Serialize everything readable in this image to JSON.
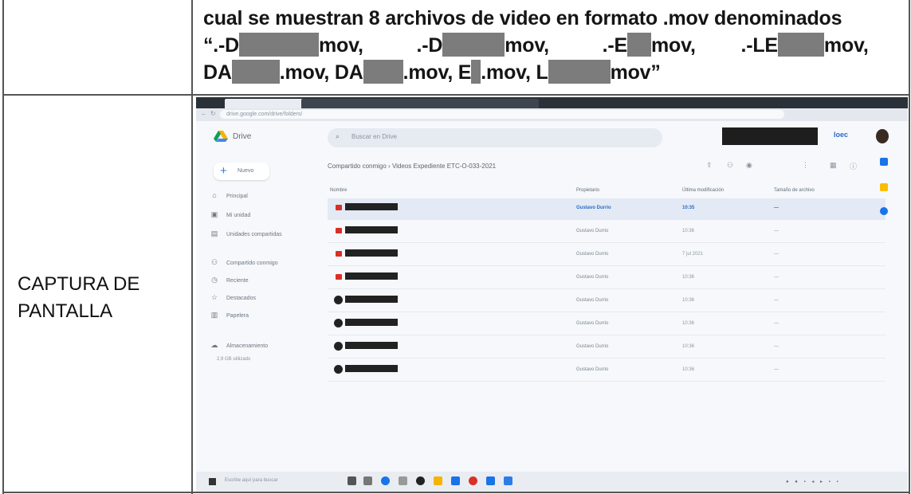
{
  "document": {
    "description_line1": "cual se muestran 8 archivos de video en formato .mov denominados",
    "line2_parts": [
      "“.-D",
      "mov,",
      ".-D",
      "mov,",
      ".-E",
      "mov,",
      ".-LE",
      "mov,"
    ],
    "line3_parts": [
      "DA",
      ".mov, DA",
      ".mov, E",
      ".mov, L",
      "mov”"
    ],
    "side_label_line1": "CAPTURA DE",
    "side_label_line2": "PANTALLA"
  },
  "screenshot": {
    "app_name": "Drive",
    "search_placeholder": "Buscar en Drive",
    "new_button": "Nuevo",
    "top_right_text": "loec",
    "sidebar": [
      {
        "icon": "home-icon",
        "glyph": "⌂",
        "label": "Principal"
      },
      {
        "icon": "my-drive-icon",
        "glyph": "▣",
        "label": "Mi unidad"
      },
      {
        "icon": "computers-icon",
        "glyph": "▤",
        "label": "Unidades compartidas"
      },
      {
        "icon": "shared-icon",
        "glyph": "👥",
        "label": "Compartido conmigo"
      },
      {
        "icon": "recent-icon",
        "glyph": "◷",
        "label": "Reciente"
      },
      {
        "icon": "starred-icon",
        "glyph": "☆",
        "label": "Destacados"
      },
      {
        "icon": "trash-icon",
        "glyph": "🗑",
        "label": "Papelera"
      },
      {
        "icon": "storage-icon",
        "glyph": "☁",
        "label": "Almacenamiento"
      }
    ],
    "storage_text": "2,9 GB utilizado",
    "breadcrumb": [
      "Compartido conmigo",
      "Videos Expediente ETC-O-033-2021"
    ],
    "columns": [
      "Nombre",
      "Propietario",
      "Última modificación",
      "Tamaño de archivo"
    ],
    "files": [
      {
        "type": "video",
        "owner": "Gustavo Durrio",
        "modified": "10:35",
        "size": "—",
        "selected": true
      },
      {
        "type": "video",
        "owner": "Gustavo Durrio",
        "modified": "10:36",
        "size": "—",
        "selected": false
      },
      {
        "type": "video",
        "owner": "Gustavo Durrio",
        "modified": "7 jul 2021",
        "size": "—",
        "selected": false
      },
      {
        "type": "video",
        "owner": "Gustavo Durrio",
        "modified": "10:36",
        "size": "—",
        "selected": false
      },
      {
        "type": "mov",
        "owner": "Gustavo Durrio",
        "modified": "10:36",
        "size": "—",
        "selected": false
      },
      {
        "type": "mov",
        "owner": "Gustavo Durrio",
        "modified": "10:36",
        "size": "—",
        "selected": false
      },
      {
        "type": "mov",
        "owner": "Gustavo Durrio",
        "modified": "10:36",
        "size": "—",
        "selected": false
      },
      {
        "type": "mov",
        "owner": "Gustavo Durrio",
        "modified": "10:36",
        "size": "—",
        "selected": false
      }
    ],
    "taskbar_search": "Escribe aquí para buscar",
    "address": "drive.google.com/drive/folders/"
  }
}
